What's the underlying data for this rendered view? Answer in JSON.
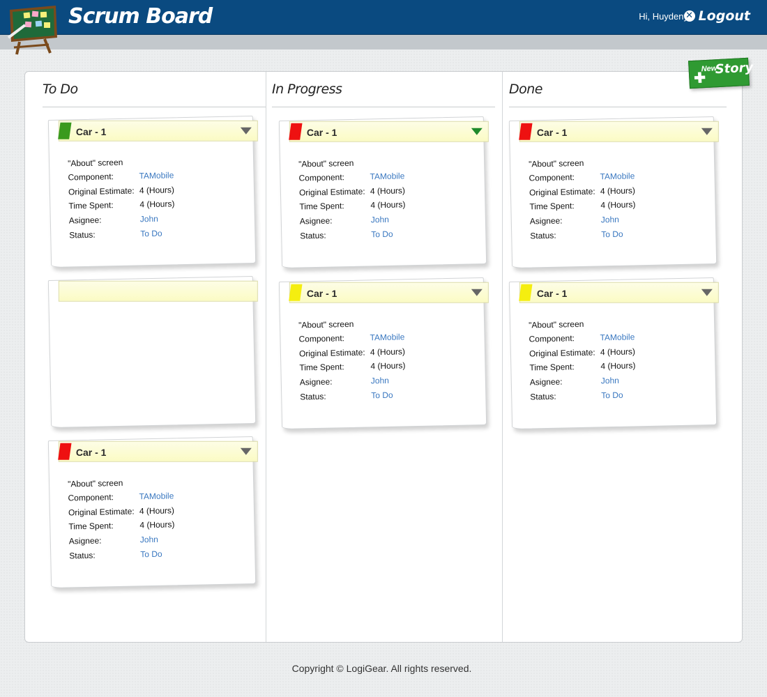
{
  "header": {
    "app_title": "Scrum Board",
    "greeting": "Hi, Huydeny",
    "logout_label": "Logout"
  },
  "new_story": {
    "small": "New",
    "big": "Story"
  },
  "columns": [
    {
      "title": "To Do"
    },
    {
      "title": "In Progress"
    },
    {
      "title": "Done"
    }
  ],
  "card_labels": {
    "component": "Component:",
    "original_estimate": "Original Estimate:",
    "time_spent": "Time Spent:",
    "asignee": "Asignee:",
    "status": "Status:"
  },
  "cards": [
    {
      "title": "Car - 1",
      "flag_color": "#3a9a1e",
      "summary": "\"About\" screen",
      "component": "TAMobile",
      "original_estimate": "4 (Hours)",
      "time_spent": "4 (Hours)",
      "asignee": "John",
      "status": "To Do"
    },
    {
      "title": "",
      "flag_color": "",
      "summary": "",
      "component": "",
      "original_estimate": "",
      "time_spent": "",
      "asignee": "",
      "status": ""
    },
    {
      "title": "Car - 1",
      "flag_color": "#ee1111",
      "summary": "\"About\" screen",
      "component": "TAMobile",
      "original_estimate": "4 (Hours)",
      "time_spent": "4 (Hours)",
      "asignee": "John",
      "status": "To Do"
    },
    {
      "title": "Car - 1",
      "flag_color": "#ee1111",
      "summary": "\"About\" screen",
      "component": "TAMobile",
      "original_estimate": "4 (Hours)",
      "time_spent": "4 (Hours)",
      "asignee": "John",
      "status": "To Do"
    },
    {
      "title": "Car - 1",
      "flag_color": "#f5ee10",
      "summary": "\"About\" screen",
      "component": "TAMobile",
      "original_estimate": "4 (Hours)",
      "time_spent": "4 (Hours)",
      "asignee": "John",
      "status": "To Do"
    },
    {
      "title": "Car - 1",
      "flag_color": "#ee1111",
      "summary": "\"About\" screen",
      "component": "TAMobile",
      "original_estimate": "4 (Hours)",
      "time_spent": "4 (Hours)",
      "asignee": "John",
      "status": "To Do"
    },
    {
      "title": "Car - 1",
      "flag_color": "#f5ee10",
      "summary": "\"About\" screen",
      "component": "TAMobile",
      "original_estimate": "4 (Hours)",
      "time_spent": "4 (Hours)",
      "asignee": "John",
      "status": "To Do"
    }
  ],
  "footer": {
    "copyright": "Copyright © LogiGear. All rights reserved."
  }
}
